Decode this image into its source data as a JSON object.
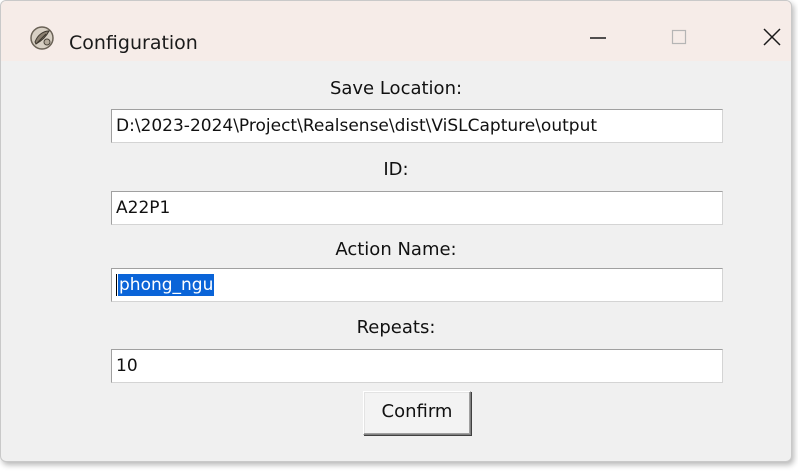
{
  "window": {
    "title": "Configuration",
    "icon": "tk-feather-icon"
  },
  "titlebar_controls": {
    "minimize": "minimize-icon",
    "maximize": "maximize-icon",
    "close": "close-icon"
  },
  "form": {
    "save_location": {
      "label": "Save Location:",
      "value": "D:\\2023-2024\\Project\\Realsense\\dist\\ViSLCapture\\output"
    },
    "id": {
      "label": "ID:",
      "value": "A22P1"
    },
    "action_name": {
      "label": "Action Name:",
      "value": "phong_ngu"
    },
    "repeats": {
      "label": "Repeats:",
      "value": "10"
    },
    "confirm_label": "Confirm"
  },
  "colors": {
    "selection": "#0a64d8",
    "titlebar": "#f6ece8",
    "window_bg": "#f0f0f0"
  }
}
